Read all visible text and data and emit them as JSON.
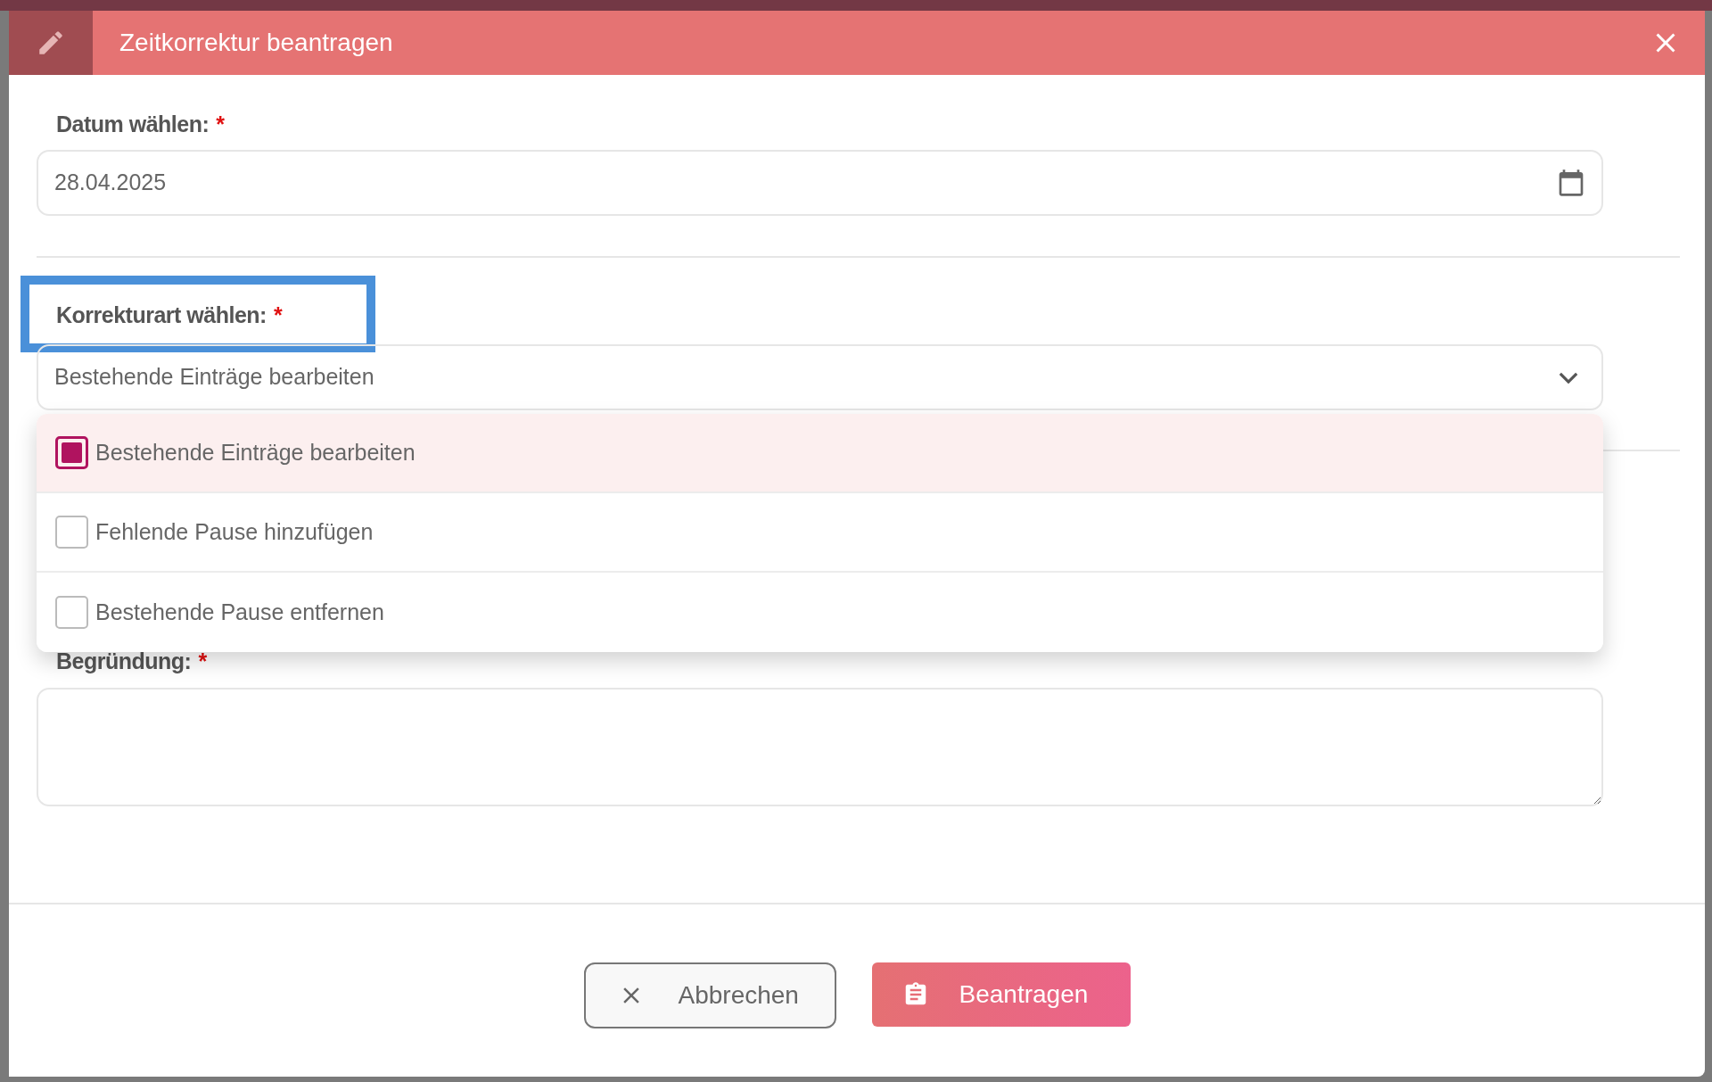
{
  "dialog": {
    "title": "Zeitkorrektur beantragen"
  },
  "date_field": {
    "label": "Datum wählen:",
    "required_mark": "*",
    "value": "28.04.2025"
  },
  "correction_type": {
    "label": "Korrekturart wählen:",
    "required_mark": "*",
    "highlighted": true,
    "value": "Bestehende Einträge bearbeiten",
    "expanded": true,
    "options": [
      {
        "label": "Bestehende Einträge bearbeiten",
        "selected": true
      },
      {
        "label": "Fehlende Pause hinzufügen",
        "selected": false
      },
      {
        "label": "Bestehende Pause entfernen",
        "selected": false
      }
    ]
  },
  "reason_field": {
    "label": "Begründung:",
    "required_mark": "*"
  },
  "buttons": [
    {
      "label": "Abbrechen",
      "kind": "cancel"
    },
    {
      "label": "Beantragen",
      "kind": "submit"
    }
  ]
}
